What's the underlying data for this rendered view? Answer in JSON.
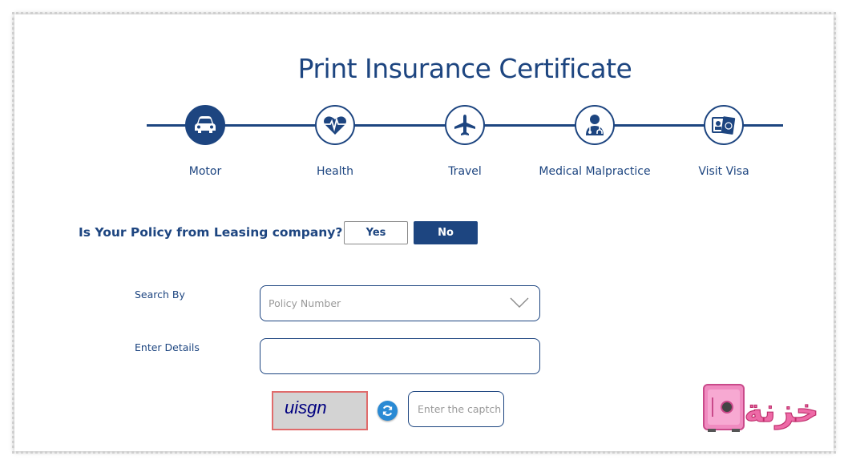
{
  "page": {
    "title": "Print Insurance Certificate"
  },
  "steps": [
    {
      "label": "Motor",
      "icon": "car-icon",
      "active": true
    },
    {
      "label": "Health",
      "icon": "heart-pulse-icon",
      "active": false
    },
    {
      "label": "Travel",
      "icon": "airplane-icon",
      "active": false
    },
    {
      "label": "Medical Malpractice",
      "icon": "doctor-icon",
      "active": false
    },
    {
      "label": "Visit Visa",
      "icon": "passport-icon",
      "active": false
    }
  ],
  "leasing": {
    "question": "Is Your Policy from Leasing company?",
    "yes_label": "Yes",
    "no_label": "No",
    "selected": "No"
  },
  "form": {
    "search_by_label": "Search By",
    "search_by_value": "Policy Number",
    "enter_details_label": "Enter Details",
    "enter_details_value": "",
    "captcha_text": "uisgn",
    "captcha_placeholder": "Enter the captch"
  },
  "colors": {
    "brand": "#1d4580",
    "captcha_border": "#e06b6b",
    "refresh": "#2a8ad4"
  },
  "watermark": {
    "label": "خزنة"
  }
}
